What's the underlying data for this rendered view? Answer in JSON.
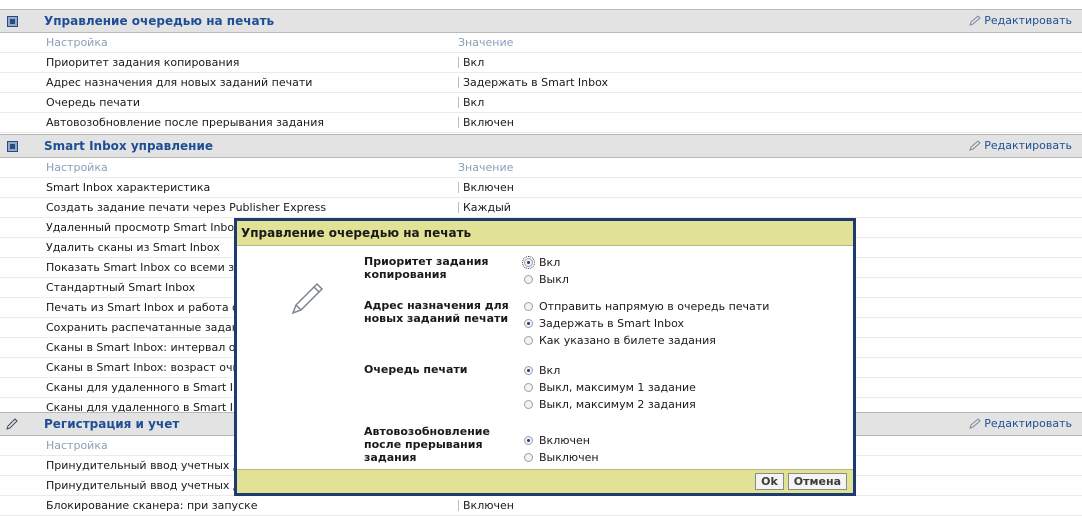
{
  "common": {
    "edit_label": "Редактировать",
    "col_setting": "Настройка",
    "col_value": "Значение"
  },
  "sections": [
    {
      "title": "Управление очередью на печать",
      "rows": [
        {
          "name": "Приоритет задания копирования",
          "value": "Вкл"
        },
        {
          "name": "Адрес назначения для новых заданий печати",
          "value": "Задержать в Smart Inbox"
        },
        {
          "name": "Очередь печати",
          "value": "Вкл"
        },
        {
          "name": "Автовозобновление после прерывания задания",
          "value": "Включен"
        }
      ]
    },
    {
      "title": "Smart Inbox управление",
      "rows": [
        {
          "name": "Smart Inbox характеристика",
          "value": "Включен"
        },
        {
          "name": "Создать задание печати через Publisher Express",
          "value": "Каждый"
        },
        {
          "name": "Удаленный просмотр Smart Inbox",
          "value": ""
        },
        {
          "name": "Удалить сканы из Smart Inbox",
          "value": ""
        },
        {
          "name": "Показать Smart Inbox со всеми зада",
          "value": ""
        },
        {
          "name": "Стандартный Smart Inbox",
          "value": ""
        },
        {
          "name": "Печать из Smart Inbox и работа с оч",
          "value": ""
        },
        {
          "name": "Сохранить распечатанные задания",
          "value": ""
        },
        {
          "name": "Сканы в Smart Inbox: интервал очис",
          "value": ""
        },
        {
          "name": "Сканы в Smart Inbox: возраст очист",
          "value": ""
        },
        {
          "name": "Сканы для удаленного в Smart Inbox",
          "value": ""
        },
        {
          "name": "Сканы для удаленного в Smart Inbox",
          "value": ""
        }
      ]
    },
    {
      "title": "Регистрация и учет",
      "rows": [
        {
          "name": "Принудительный ввод учетных данн",
          "value": ""
        },
        {
          "name": "Принудительный ввод учетных данн",
          "value": ""
        },
        {
          "name": "Блокирование сканера: при запуске",
          "value": "Включен"
        }
      ]
    }
  ],
  "dialog": {
    "title": "Управление очередью на печать",
    "groups": [
      {
        "label": "Приоритет задания копирования",
        "options": [
          {
            "label": "Вкл",
            "selected": true
          },
          {
            "label": "Выкл",
            "selected": false
          }
        ]
      },
      {
        "label": "Адрес назначения для новых заданий печати",
        "options": [
          {
            "label": "Отправить напрямую в очередь печати",
            "selected": false
          },
          {
            "label": "Задержать в Smart Inbox",
            "selected": true
          },
          {
            "label": "Как указано в билете задания",
            "selected": false
          }
        ]
      },
      {
        "label": "Очередь печати",
        "options": [
          {
            "label": "Вкл",
            "selected": true
          },
          {
            "label": "Выкл, максимум 1 задание",
            "selected": false
          },
          {
            "label": "Выкл, максимум 2 задания",
            "selected": false
          }
        ]
      },
      {
        "label": "Автовозобновление после прерывания задания",
        "options": [
          {
            "label": "Включен",
            "selected": true
          },
          {
            "label": "Выключен",
            "selected": false
          }
        ]
      }
    ],
    "ok_label": "Ok",
    "cancel_label": "Отмена"
  },
  "colors": {
    "section_title": "#1e4f96",
    "dialog_bar": "#e2e296",
    "dialog_border": "#1c3c70"
  }
}
